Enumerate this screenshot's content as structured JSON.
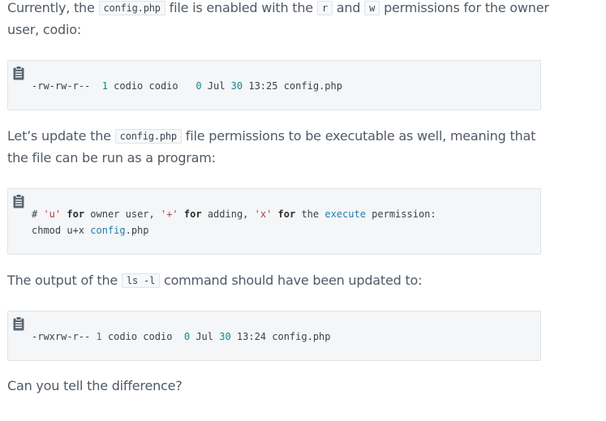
{
  "paragraphs": {
    "p1": {
      "text_a": "Currently, the ",
      "code_a": "config.php",
      "text_b": " file is enabled with the ",
      "code_b": "r",
      "text_c": " and ",
      "code_c": "w",
      "text_d": " permissions for the owner user, codio:"
    },
    "p2": {
      "text_a": "Let’s update the ",
      "code_a": "config.php",
      "text_b": " file permissions to be executable as well, meaning that the file can be run as a program:"
    },
    "p3": {
      "text_a": "The output of the ",
      "code_a": "ls -l",
      "text_b": " command should have been updated to:"
    },
    "p4": {
      "text": "Can you tell the difference?"
    }
  },
  "code_blocks": {
    "block1": {
      "perm": "-rw-rw-r--  ",
      "links": "1",
      "owner_group": " codio codio   ",
      "size": "0",
      "month": " Jul ",
      "day": "30",
      "time_file": " 13:25 config.php"
    },
    "block2": {
      "line1": {
        "hash": "# ",
        "s1": "'u'",
        "t1": " ",
        "for1": "for",
        "t2": " owner user, ",
        "s2": "'+'",
        "t3": " ",
        "for2": "for",
        "t4": " adding, ",
        "s3": "'x'",
        "t5": " ",
        "for3": "for",
        "t6": " the ",
        "execute": "execute",
        "t7": " permission:"
      },
      "line2": {
        "cmd": "chmod u+x ",
        "config": "config",
        "ext": ".php"
      }
    },
    "block3": {
      "perm": "-rwxrw-r-- ",
      "links": "1",
      "owner_group": " codio codio  ",
      "size": "0",
      "month": " Jul ",
      "day": "30",
      "time_file": " 13:24 config.php"
    }
  },
  "icons": {
    "copy": "clipboard-icon"
  }
}
